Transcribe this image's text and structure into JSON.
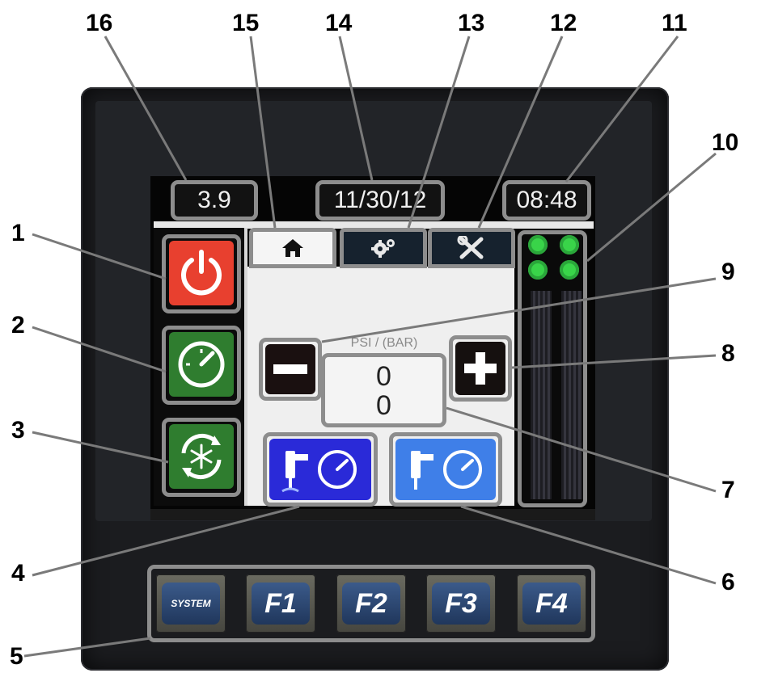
{
  "status_bar": {
    "value": "3.9",
    "date": "11/30/12",
    "time": "08:48"
  },
  "tabs": [
    {
      "icon": "home-icon",
      "active": true
    },
    {
      "icon": "gears-icon",
      "active": false
    },
    {
      "icon": "tools-icon",
      "active": false
    }
  ],
  "left_buttons": [
    {
      "icon": "power-icon",
      "color": "#e8402f"
    },
    {
      "icon": "gauge-icon",
      "color": "#2f7d2f"
    },
    {
      "icon": "snowflake-cycle-icon",
      "color": "#2f7d2f"
    }
  ],
  "pressure": {
    "label": "PSI / (BAR)",
    "psi_value": "0",
    "bar_value": "0"
  },
  "bottom_buttons": [
    {
      "icon": "spray-gun-gauge-icon",
      "color": "#2a2ad8"
    },
    {
      "icon": "spray-gun-gauge-icon",
      "color": "#3f7fe8"
    }
  ],
  "indicators": {
    "count": 4,
    "color": "#39d449"
  },
  "function_keys": [
    "SYSTEM",
    "F1",
    "F2",
    "F3",
    "F4"
  ],
  "callouts": [
    "1",
    "2",
    "3",
    "4",
    "5",
    "6",
    "7",
    "8",
    "9",
    "10",
    "11",
    "12",
    "13",
    "14",
    "15",
    "16"
  ]
}
